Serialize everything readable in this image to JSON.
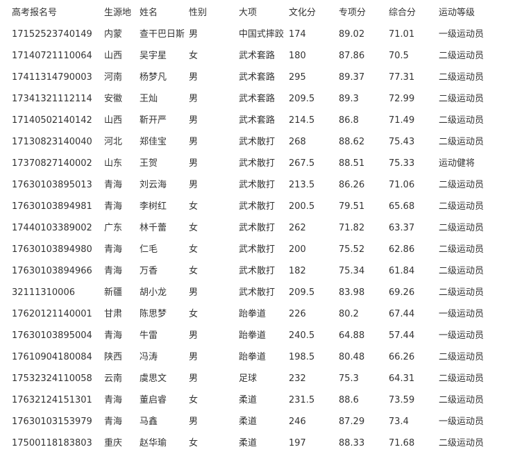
{
  "table": {
    "headers": [
      "高考报名号",
      "生源地",
      "姓名",
      "性别",
      "大项",
      "文化分",
      "专项分",
      "综合分",
      "运动等级"
    ],
    "rows": [
      [
        "17152523740149",
        "内蒙",
        "查干巴日斯",
        "男",
        "中国式摔跤",
        "174",
        "89.02",
        "71.01",
        "一级运动员"
      ],
      [
        "17140721110064",
        "山西",
        "吴宇星",
        "女",
        "武术套路",
        "180",
        "87.86",
        "70.5",
        "二级运动员"
      ],
      [
        "17411314790003",
        "河南",
        "杨梦凡",
        "男",
        "武术套路",
        "295",
        "89.37",
        "77.31",
        "二级运动员"
      ],
      [
        "17341321112114",
        "安徽",
        "王灿",
        "男",
        "武术套路",
        "209.5",
        "89.3",
        "72.99",
        "二级运动员"
      ],
      [
        "17140502140142",
        "山西",
        "靳开严",
        "男",
        "武术套路",
        "214.5",
        "86.8",
        "71.49",
        "二级运动员"
      ],
      [
        "17130823140040",
        "河北",
        "郑佳宝",
        "男",
        "武术散打",
        "268",
        "88.62",
        "75.43",
        "二级运动员"
      ],
      [
        "17370827140002",
        "山东",
        "王贺",
        "男",
        "武术散打",
        "267.5",
        "88.51",
        "75.33",
        "运动健将"
      ],
      [
        "17630103895013",
        "青海",
        "刘云海",
        "男",
        "武术散打",
        "213.5",
        "86.26",
        "71.06",
        "二级运动员"
      ],
      [
        "17630103894981",
        "青海",
        "李树红",
        "女",
        "武术散打",
        "200.5",
        "79.51",
        "65.68",
        "二级运动员"
      ],
      [
        "17440103389002",
        "广东",
        "林千蕾",
        "女",
        "武术散打",
        "262",
        "71.82",
        "63.37",
        "二级运动员"
      ],
      [
        "17630103894980",
        "青海",
        "仁毛",
        "女",
        "武术散打",
        "200",
        "75.52",
        "62.86",
        "二级运动员"
      ],
      [
        "17630103894966",
        "青海",
        "万香",
        "女",
        "武术散打",
        "182",
        "75.34",
        "61.84",
        "二级运动员"
      ],
      [
        "32111310006",
        "新疆",
        "胡小龙",
        "男",
        "武术散打",
        "209.5",
        "83.98",
        "69.26",
        "二级运动员"
      ],
      [
        "17620121140001",
        "甘肃",
        "陈思梦",
        "女",
        "跆拳道",
        "226",
        "80.2",
        "67.44",
        "一级运动员"
      ],
      [
        "17630103895004",
        "青海",
        "牛雷",
        "男",
        "跆拳道",
        "240.5",
        "64.88",
        "57.44",
        "一级运动员"
      ],
      [
        "17610904180084",
        "陕西",
        "冯涛",
        "男",
        "跆拳道",
        "198.5",
        "80.48",
        "66.26",
        "二级运动员"
      ],
      [
        "17532324110058",
        "云南",
        "虞思文",
        "男",
        "足球",
        "232",
        "75.3",
        "64.31",
        "二级运动员"
      ],
      [
        "17632124151301",
        "青海",
        "董启睿",
        "女",
        "柔道",
        "231.5",
        "88.6",
        "73.59",
        "二级运动员"
      ],
      [
        "17630103153979",
        "青海",
        "马鑫",
        "男",
        "柔道",
        "246",
        "87.29",
        "73.4",
        "一级运动员"
      ],
      [
        "17500118183803",
        "重庆",
        "赵华瑜",
        "女",
        "柔道",
        "197",
        "88.33",
        "71.68",
        "二级运动员"
      ]
    ]
  }
}
